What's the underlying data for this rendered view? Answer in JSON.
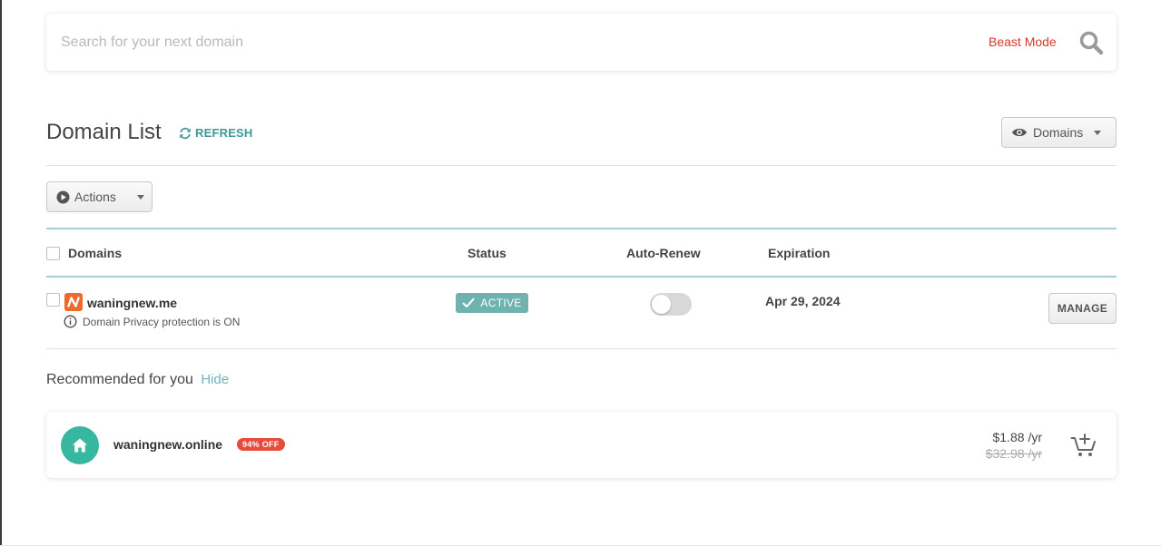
{
  "search": {
    "placeholder": "Search for your next domain",
    "beast_mode_label": "Beast Mode",
    "icon": "search-icon"
  },
  "header": {
    "title": "Domain List",
    "refresh_label": "REFRESH",
    "filter_label": "Domains"
  },
  "toolbar": {
    "actions_label": "Actions"
  },
  "table": {
    "columns": [
      "Domains",
      "Status",
      "Auto-Renew",
      "Expiration"
    ],
    "rows": [
      {
        "domain": "waningnew.me",
        "privacy": "Domain Privacy protection is ON",
        "status": "ACTIVE",
        "auto_renew": false,
        "expiration": "Apr 29, 2024",
        "manage_label": "MANAGE"
      }
    ]
  },
  "recommended": {
    "heading": "Recommended for you",
    "hide_label": "Hide",
    "items": [
      {
        "domain": "waningnew.online",
        "discount": "94% OFF",
        "price": "$1.88 /yr",
        "old_price": "$32.98 /yr"
      }
    ]
  },
  "colors": {
    "accent_teal": "#3f9a97",
    "beast_mode_red": "#d9352b",
    "status_active": "#6fb3b0",
    "brand_orange": "#ee6a2b",
    "home_green": "#37b79f",
    "discount_red": "#e64b3c"
  }
}
